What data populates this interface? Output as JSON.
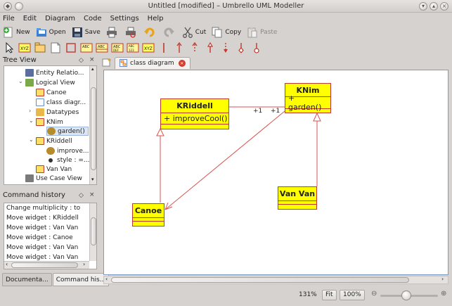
{
  "window": {
    "title": "Untitled [modified] – Umbrello UML Modeller"
  },
  "menu": [
    "File",
    "Edit",
    "Diagram",
    "Code",
    "Settings",
    "Help"
  ],
  "toolbar": {
    "new": "New",
    "open": "Open",
    "save": "Save",
    "cut": "Cut",
    "copy": "Copy",
    "paste": "Paste"
  },
  "tree_panel": {
    "title": "Tree View",
    "items": [
      {
        "label": "Entity Relatio...",
        "icon": "folder-icon"
      },
      {
        "label": "Logical View",
        "icon": "folder-icon"
      },
      {
        "label": "Canoe",
        "icon": "class-icon"
      },
      {
        "label": "class diagr...",
        "icon": "diagram-icon"
      },
      {
        "label": "Datatypes",
        "icon": "folder-icon"
      },
      {
        "label": "KNim",
        "icon": "class-icon"
      },
      {
        "label": "garden()",
        "icon": "operation-icon"
      },
      {
        "label": "KRiddell",
        "icon": "class-icon"
      },
      {
        "label": "improve...",
        "icon": "operation-icon"
      },
      {
        "label": "style : =...",
        "icon": "attribute-icon"
      },
      {
        "label": "Van Van",
        "icon": "class-icon"
      },
      {
        "label": "Use Case View",
        "icon": "folder-icon"
      }
    ]
  },
  "history_panel": {
    "title": "Command history",
    "items": [
      "Change multiplicity :  to",
      "Move widget : KRiddell",
      "Move widget : Van Van",
      "Move widget : Canoe",
      "Move widget : Van Van",
      "Move widget : Van Van"
    ]
  },
  "bottom_tabs": [
    "Documenta...",
    "Command his..."
  ],
  "diagram_tab": {
    "label": "class diagram"
  },
  "diagram": {
    "classes": [
      {
        "name": "KRiddell",
        "operation": "+ improveCool()"
      },
      {
        "name": "KNim",
        "operation": "+ garden()"
      },
      {
        "name": "Canoe",
        "operation": ""
      },
      {
        "name": "Van Van",
        "operation": ""
      }
    ],
    "multiplicities": [
      "+1",
      "+1"
    ]
  },
  "status": {
    "zoom": "131%",
    "fit": "Fit",
    "hundred": "100%",
    "zoom_level_fraction": 0.45
  },
  "colors": {
    "class_fill": "#ffff00",
    "class_border": "#c0392b",
    "relation_line": "#d9534f",
    "canvas_border": "#7a9bc7"
  }
}
